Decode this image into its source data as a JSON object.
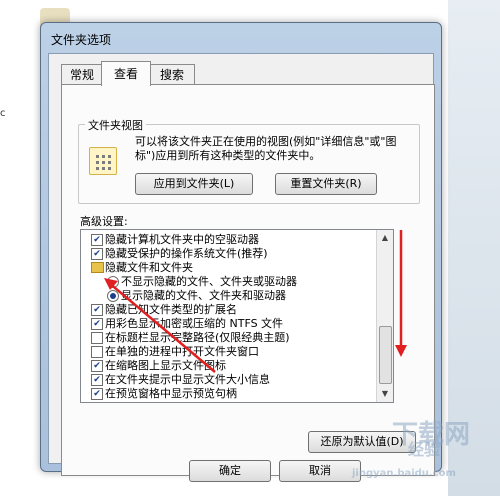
{
  "dialog": {
    "title": "文件夹选项"
  },
  "tabs": [
    {
      "label": "常规",
      "active": false
    },
    {
      "label": "查看",
      "active": true
    },
    {
      "label": "搜索",
      "active": false
    }
  ],
  "folder_views": {
    "title": "文件夹视图",
    "description": "可以将该文件夹正在使用的视图(例如\"详细信息\"或\"图标\")应用到所有这种类型的文件夹中。",
    "apply_button": "应用到文件夹(L)",
    "reset_button": "重置文件夹(R)"
  },
  "advanced": {
    "label": "高级设置:",
    "items": [
      {
        "type": "checkbox",
        "checked": true,
        "label": "隐藏计算机文件夹中的空驱动器"
      },
      {
        "type": "checkbox",
        "checked": true,
        "label": "隐藏受保护的操作系统文件(推荐)"
      },
      {
        "type": "folder",
        "label": "隐藏文件和文件夹"
      },
      {
        "type": "radio",
        "selected": false,
        "label": "不显示隐藏的文件、文件夹或驱动器"
      },
      {
        "type": "radio",
        "selected": true,
        "label": "显示隐藏的文件、文件夹和驱动器"
      },
      {
        "type": "checkbox",
        "checked": true,
        "label": "隐藏已知文件类型的扩展名"
      },
      {
        "type": "checkbox",
        "checked": true,
        "label": "用彩色显示加密或压缩的 NTFS 文件"
      },
      {
        "type": "checkbox",
        "checked": false,
        "label": "在标题栏显示完整路径(仅限经典主题)"
      },
      {
        "type": "checkbox",
        "checked": false,
        "label": "在单独的进程中打开文件夹窗口"
      },
      {
        "type": "checkbox",
        "checked": true,
        "label": "在缩略图上显示文件图标"
      },
      {
        "type": "checkbox",
        "checked": true,
        "label": "在文件夹提示中显示文件大小信息"
      },
      {
        "type": "checkbox",
        "checked": true,
        "label": "在预览窗格中显示预览句柄"
      }
    ],
    "restore_button": "还原为默认值(D)"
  },
  "footer": {
    "ok": "确定",
    "cancel": "取消"
  },
  "background": {
    "left_fragment": "c"
  },
  "watermark": {
    "logo": "下载网",
    "sub": "jingyan.baidu.com",
    "extra": "经验"
  },
  "colors": {
    "annotation_arrow": "#e02020",
    "check_mark": "#1a3e8e"
  }
}
